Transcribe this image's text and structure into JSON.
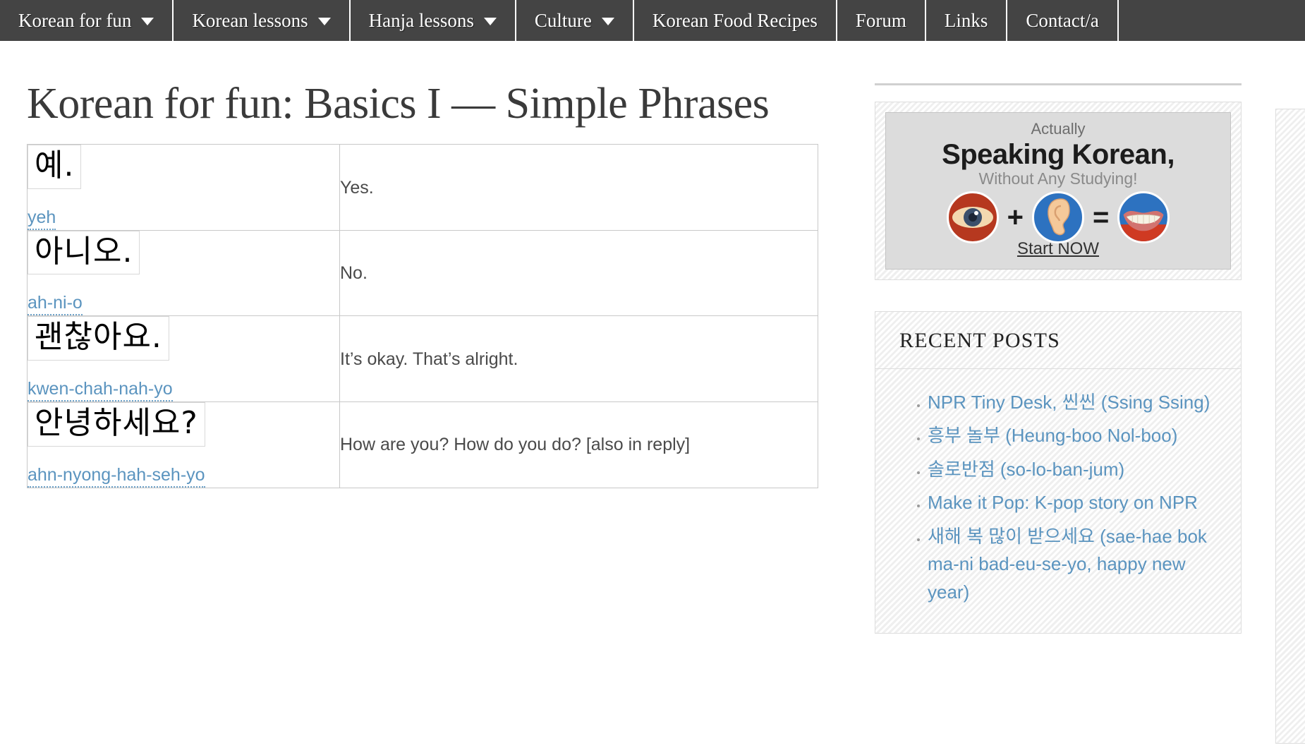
{
  "nav": {
    "items": [
      {
        "label": "Korean for fun",
        "has_dropdown": true
      },
      {
        "label": "Korean lessons",
        "has_dropdown": true
      },
      {
        "label": "Hanja lessons",
        "has_dropdown": true
      },
      {
        "label": "Culture",
        "has_dropdown": true
      },
      {
        "label": "Korean Food Recipes",
        "has_dropdown": false
      },
      {
        "label": "Forum",
        "has_dropdown": false
      },
      {
        "label": "Links",
        "has_dropdown": false
      },
      {
        "label": "Contact/a",
        "has_dropdown": false
      }
    ]
  },
  "main": {
    "title": "Korean for fun: Basics I — Simple Phrases",
    "table": {
      "rows": [
        {
          "hangul": "예.",
          "romanization": "yeh",
          "meaning": "Yes."
        },
        {
          "hangul": "아니오.",
          "romanization": "ah-ni-o",
          "meaning": "No."
        },
        {
          "hangul": "괜찮아요.",
          "romanization": "kwen-chah-nah-yo",
          "meaning": "It’s okay.  That’s alright."
        },
        {
          "hangul": "안녕하세요?",
          "romanization": "ahn-nyong-hah-seh-yo",
          "meaning": "How are you?  How do you do? [also in reply]"
        }
      ]
    }
  },
  "sidebar": {
    "ad": {
      "line1": "Actually",
      "line2": "Speaking Korean,",
      "line3": "Without Any Studying!",
      "icon_eye": "eye-icon",
      "icon_plus": "+",
      "icon_ear": "ear-icon",
      "icon_equals": "=",
      "icon_mouth": "mouth-icon",
      "cta": "Start NOW"
    },
    "recent_posts": {
      "title": "RECENT POSTS",
      "items": [
        "NPR Tiny Desk, 씬씬 (Ssing Ssing)",
        "흥부 놀부 (Heung-boo Nol-boo)",
        "솔로반점 (so-lo-ban-jum)",
        "Make it Pop: K-pop story on NPR",
        "새해 복 많이 받으세요 (sae-hae bok ma-ni bad-eu-se-yo, happy new year)"
      ]
    }
  },
  "colors": {
    "nav_bg": "#444444",
    "link_blue": "#5b94bf",
    "text_gray": "#4a4a4a",
    "title_gray": "#3a3a3a",
    "border_gray": "#c8c8c8"
  }
}
